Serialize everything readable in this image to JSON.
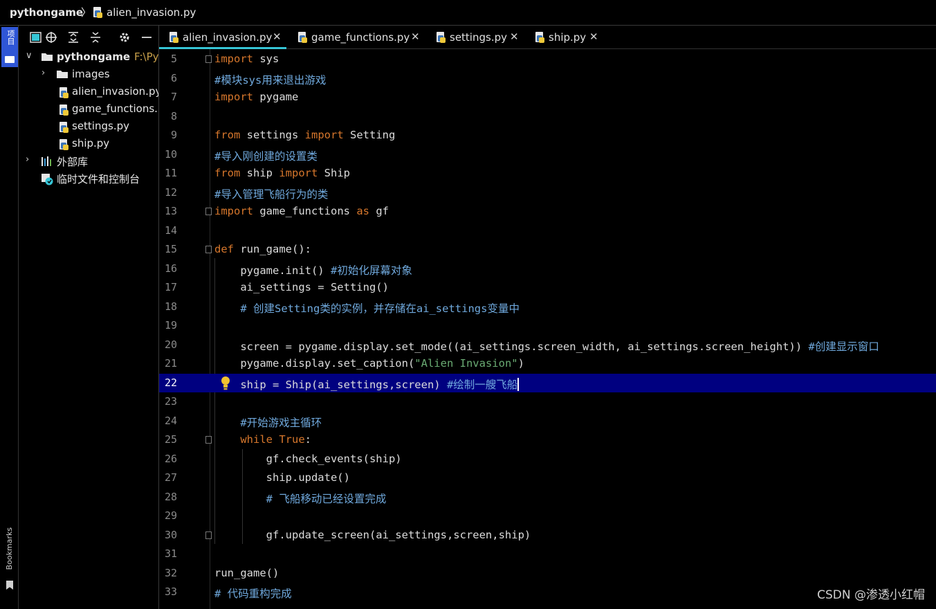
{
  "breadcrumb": {
    "project": "pythongame",
    "separator": "〉",
    "file": "alien_invasion.py"
  },
  "left_strip": {
    "project_label": "项目",
    "bookmarks_label": "Bookmarks"
  },
  "project_tree": [
    {
      "label": "pythongame",
      "hint": "F:\\Pyt",
      "type": "folder",
      "level": 0,
      "expanded": true,
      "bold": true
    },
    {
      "label": "images",
      "type": "folder",
      "level": 1,
      "expanded": false
    },
    {
      "label": "alien_invasion.py",
      "type": "python",
      "level": 1
    },
    {
      "label": "game_functions.py",
      "type": "python",
      "level": 1
    },
    {
      "label": "settings.py",
      "type": "python",
      "level": 1
    },
    {
      "label": "ship.py",
      "type": "python",
      "level": 1
    },
    {
      "label": "外部库",
      "type": "library",
      "level": 0,
      "expanded": false
    },
    {
      "label": "临时文件和控制台",
      "type": "scratch",
      "level": 0
    }
  ],
  "tabs": [
    {
      "label": "alien_invasion.py",
      "active": true
    },
    {
      "label": "game_functions.py",
      "active": false
    },
    {
      "label": "settings.py",
      "active": false
    },
    {
      "label": "ship.py",
      "active": false
    }
  ],
  "tab_close": "✕",
  "code": {
    "current_line": 22,
    "lines": [
      {
        "n": "5",
        "text": "import sys"
      },
      {
        "n": "6",
        "text": "#模块sys用来退出游戏"
      },
      {
        "n": "7",
        "text": "import pygame"
      },
      {
        "n": "8",
        "text": ""
      },
      {
        "n": "9",
        "text": "from settings import Setting"
      },
      {
        "n": "10",
        "text": "#导入刚创建的设置类"
      },
      {
        "n": "11",
        "text": "from ship import Ship"
      },
      {
        "n": "12",
        "text": "#导入管理飞船行为的类"
      },
      {
        "n": "13",
        "text": "import game_functions as gf"
      },
      {
        "n": "14",
        "text": ""
      },
      {
        "n": "15",
        "text": "def run_game():"
      },
      {
        "n": "16",
        "text": "    pygame.init() #初始化屏幕对象"
      },
      {
        "n": "17",
        "text": "    ai_settings = Setting()"
      },
      {
        "n": "18",
        "text": "    # 创建Setting类的实例，并存储在ai_settings变量中"
      },
      {
        "n": "19",
        "text": ""
      },
      {
        "n": "20",
        "text": "    screen = pygame.display.set_mode((ai_settings.screen_width, ai_settings.screen_height)) #创建显示窗口"
      },
      {
        "n": "21",
        "text": "    pygame.display.set_caption(\"Alien Invasion\")"
      },
      {
        "n": "22",
        "text": "    ship = Ship(ai_settings,screen) #绘制一艘飞船"
      },
      {
        "n": "23",
        "text": ""
      },
      {
        "n": "24",
        "text": "    #开始游戏主循环"
      },
      {
        "n": "25",
        "text": "    while True:"
      },
      {
        "n": "26",
        "text": "        gf.check_events(ship)"
      },
      {
        "n": "27",
        "text": "        ship.update()"
      },
      {
        "n": "28",
        "text": "        # 飞船移动已经设置完成"
      },
      {
        "n": "29",
        "text": ""
      },
      {
        "n": "30",
        "text": "        gf.update_screen(ai_settings,screen,ship)"
      },
      {
        "n": "31",
        "text": ""
      },
      {
        "n": "32",
        "text": "run_game()"
      },
      {
        "n": "33",
        "text": "# 代码重构完成"
      }
    ]
  },
  "watermark": "CSDN @渗透小红帽",
  "colors": {
    "accent_tab": "#36c5d6",
    "current_line": "#000080",
    "keyword": "#d7772c",
    "comment": "#6fa8dc",
    "string": "#6aab73"
  }
}
